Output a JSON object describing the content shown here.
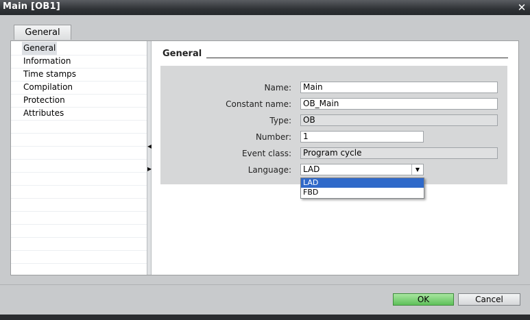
{
  "window": {
    "title": "Main [OB1]",
    "close_glyph": "✕"
  },
  "tabs": [
    {
      "label": "General"
    }
  ],
  "nav": {
    "items": [
      {
        "label": "General",
        "selected": true
      },
      {
        "label": "Information"
      },
      {
        "label": "Time stamps"
      },
      {
        "label": "Compilation"
      },
      {
        "label": "Protection"
      },
      {
        "label": "Attributes"
      }
    ]
  },
  "splitter": {
    "collapse_glyph": "◀",
    "expand_glyph": "▶"
  },
  "section": {
    "title": "General"
  },
  "form": {
    "name": {
      "label": "Name:",
      "value": "Main"
    },
    "constant_name": {
      "label": "Constant name:",
      "value": "OB_Main"
    },
    "type": {
      "label": "Type:",
      "value": "OB"
    },
    "number": {
      "label": "Number:",
      "value": "1"
    },
    "event_class": {
      "label": "Event class:",
      "value": "Program cycle"
    },
    "language": {
      "label": "Language:",
      "value": "LAD",
      "arrow": "▼",
      "options": [
        "LAD",
        "FBD"
      ]
    }
  },
  "buttons": {
    "ok": "OK",
    "cancel": "Cancel"
  },
  "colors": {
    "ok_button": "#6cc866",
    "selected_option": "#2f69c9",
    "titlebar": "#2f3236"
  }
}
